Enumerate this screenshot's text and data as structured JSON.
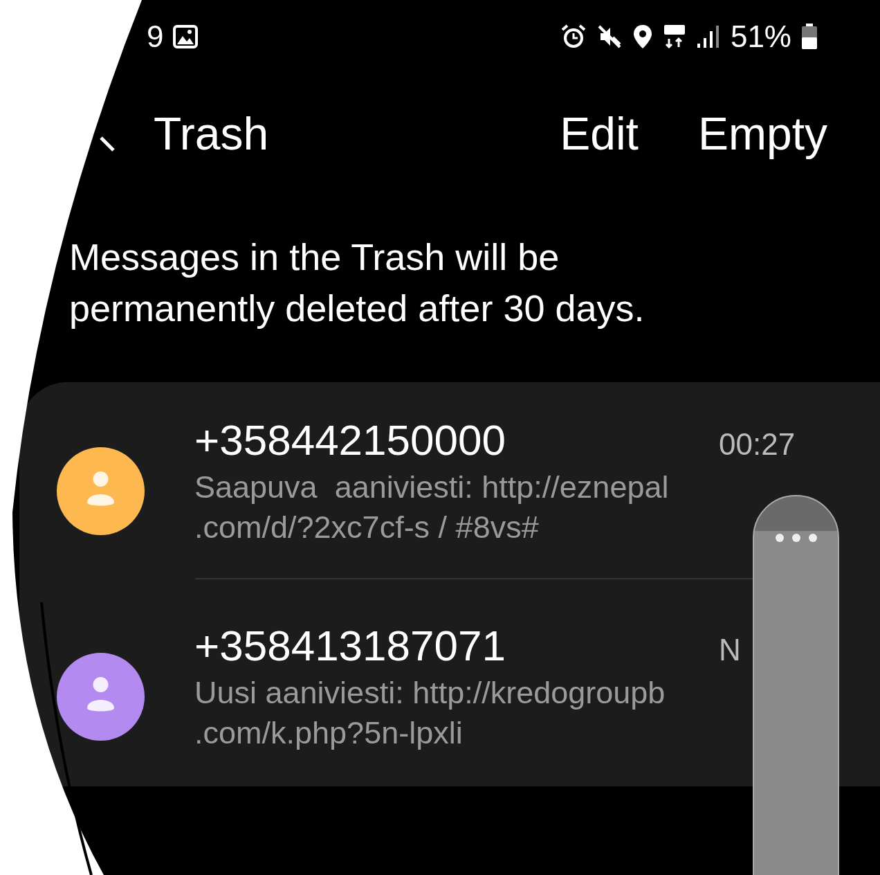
{
  "status_bar": {
    "time": "9",
    "battery": "51%"
  },
  "header": {
    "title": "Trash",
    "actions": [
      "Edit",
      "Empty"
    ]
  },
  "notice": "Messages in the Trash will be permanently deleted after 30 days.",
  "messages": [
    {
      "sender": "+358442150000",
      "time": "00:27",
      "preview": [
        "Saapuva  aaniviesti: http://eznepal",
        ".com/d/?2xc7cf-s / #8vs#"
      ],
      "color": "#fdb94f"
    },
    {
      "sender": "+358413187071",
      "time": "N",
      "preview": [
        "Uusi aaniviesti: http://kredogroupb",
        ".com/k.php?5n-lpxli"
      ],
      "color": "#b28af0"
    }
  ]
}
